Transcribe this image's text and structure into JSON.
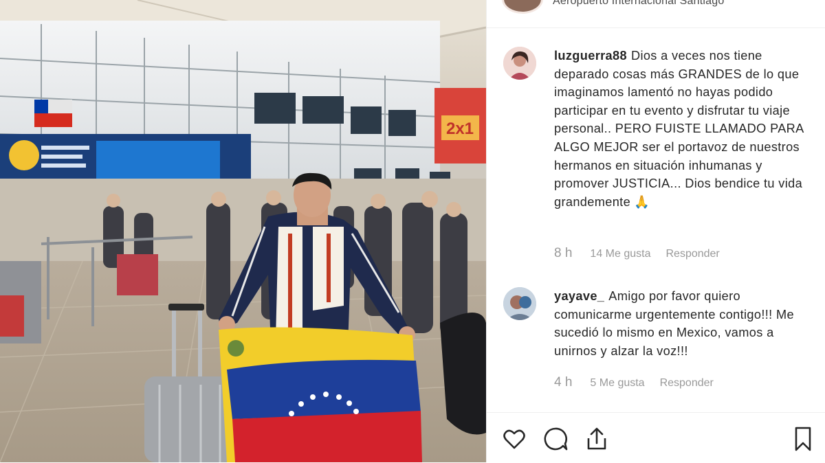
{
  "post": {
    "location": "Aeropuerto Internacional Santiago",
    "photo_sign": "2x1"
  },
  "comments": [
    {
      "username": "luzguerra88",
      "text": "Dios a veces nos tiene deparado cosas más GRANDES de lo que imaginamos lamentó no hayas podido participar en tu evento y disfrutar tu viaje personal.. PERO FUISTE LLAMADO PARA ALGO MEJOR ser el portavoz de nuestros hermanos en situación inhumanas y promover JUSTICIA... Dios bendice tu vida grandemente 🙏",
      "age": "8 h",
      "likes": "14 Me gusta",
      "reply": "Responder"
    },
    {
      "username": "yayave_",
      "text": "Amigo por favor quiero comunicarme urgentemente contigo!!! Me sucedió lo mismo en Mexico, vamos a unirnos y alzar la voz!!!",
      "age": "4 h",
      "likes": "5 Me gusta",
      "reply": "Responder"
    }
  ],
  "icons": {
    "like": "heart-icon",
    "comment": "comment-bubble-icon",
    "share": "share-icon",
    "save": "bookmark-icon"
  },
  "colors": {
    "text": "#262626",
    "meta": "#999999",
    "divider": "#efefef"
  }
}
